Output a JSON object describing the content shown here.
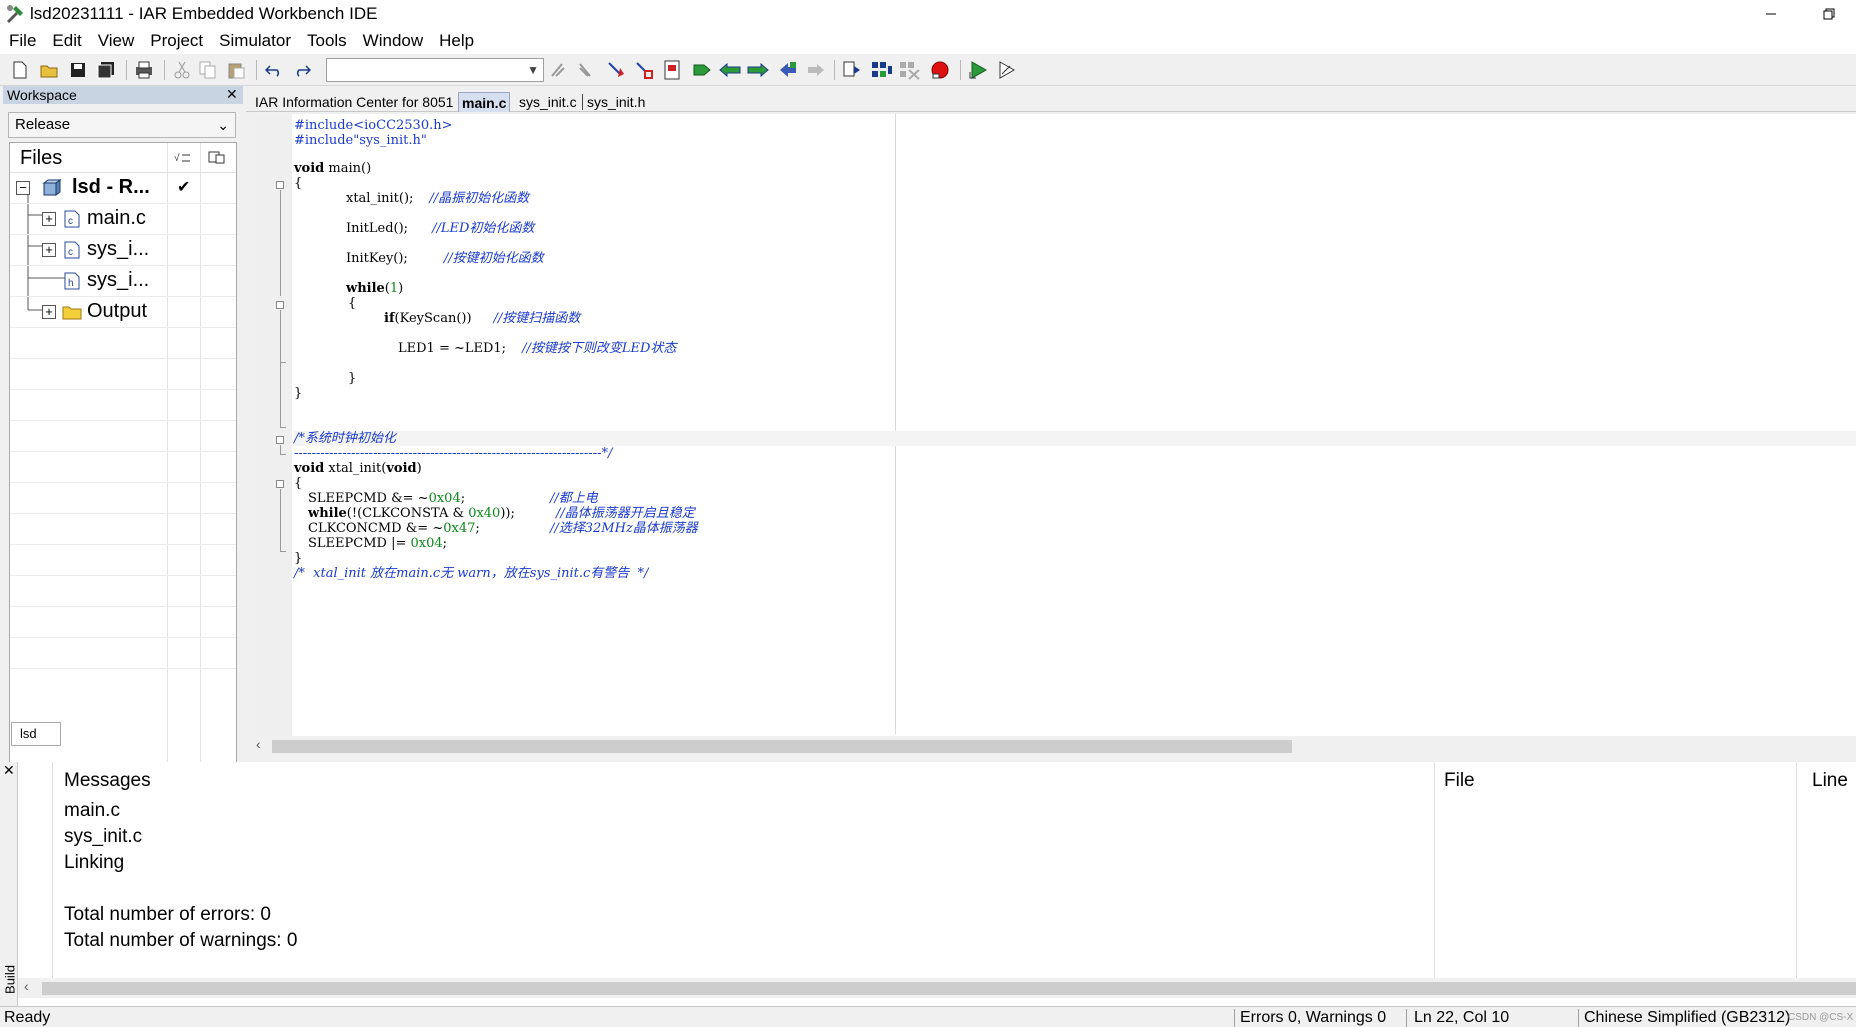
{
  "window": {
    "title": "lsd20231111 - IAR Embedded Workbench IDE"
  },
  "menu": [
    "File",
    "Edit",
    "View",
    "Project",
    "Simulator",
    "Tools",
    "Window",
    "Help"
  ],
  "workspace": {
    "title": "Workspace",
    "config": "Release",
    "files_header": "Files",
    "tree": [
      {
        "label": "lsd - R...",
        "kind": "project",
        "checked": true
      },
      {
        "label": "main.c",
        "kind": "c-file"
      },
      {
        "label": "sys_i...",
        "kind": "c-file"
      },
      {
        "label": "sys_i...",
        "kind": "h-file"
      },
      {
        "label": "Output",
        "kind": "folder"
      }
    ],
    "tab": "lsd"
  },
  "editor": {
    "tabs": [
      {
        "label": "IAR Information Center for 8051",
        "active": false
      },
      {
        "label": "main.c",
        "active": true
      },
      {
        "label": "sys_init.c",
        "active": false
      },
      {
        "label": "sys_init.h",
        "active": false
      }
    ],
    "code": {
      "inc1": "#include<ioCC2530.h>",
      "inc2": "#include\"sys_init.h\"",
      "main_sig_kw": "void",
      "main_sig_rest": " main()",
      "brace_open": "{",
      "xtal_call": "xtal_init();",
      "xtal_cm": "//晶振初始化函数",
      "initled_call": "InitLed();",
      "initled_cm": "//LED初始化函数",
      "initkey_call": "InitKey();",
      "initkey_cm": "//按键初始化函数",
      "while_kw": "while",
      "while_open": "(",
      "while_num": "1",
      "while_close": ")",
      "inner_open": "{",
      "if_kw": "if",
      "if_rest": "(KeyScan())",
      "if_cm": "//按键扫描函数",
      "led_stmt": "LED1 = ~LED1;",
      "led_cm": "//按键按下则改变LED状态",
      "inner_close": "}",
      "brace_close": "}",
      "sysclk_cm": "/*系统时钟初始化",
      "sysclk_rule": "----------------------------------------------------------------------*/",
      "xtal_sig_kw": "void",
      "xtal_sig_mid": " xtal_init(",
      "xtal_sig_kw2": "void",
      "xtal_sig_end": ")",
      "x_open": "{",
      "s1_a": "SLEEPCMD &= ~",
      "s1_n": "0x04",
      "s1_b": ";",
      "s1_cm": "//都上电",
      "s2_kw": "while",
      "s2_a": "(!(CLKCONSTA & ",
      "s2_n": "0x40",
      "s2_b": "));",
      "s2_cm": "//晶体振荡器开启且稳定",
      "s3_a": "CLKCONCMD &= ~",
      "s3_n": "0x47",
      "s3_b": ";",
      "s3_cm": "//选择32MHz晶体振荡器",
      "s4_a": "SLEEPCMD |= ",
      "s4_n": "0x04",
      "s4_b": ";",
      "x_close": "}",
      "last_cm": "/*  xtal_init 放在main.c无 warn，放在sys_init.c有警告  */"
    }
  },
  "build": {
    "side_label": "Build",
    "columns": [
      "Messages",
      "File",
      "Line"
    ],
    "lines": [
      "main.c",
      "sys_init.c",
      "Linking",
      "",
      "Total number of errors: 0",
      "Total number of warnings: 0"
    ]
  },
  "status": {
    "ready": "Ready",
    "errors": "Errors 0, Warnings 0",
    "position": "Ln 22, Col 10",
    "encoding": "Chinese Simplified (GB2312)",
    "watermark": "CSDN @CS-X"
  }
}
